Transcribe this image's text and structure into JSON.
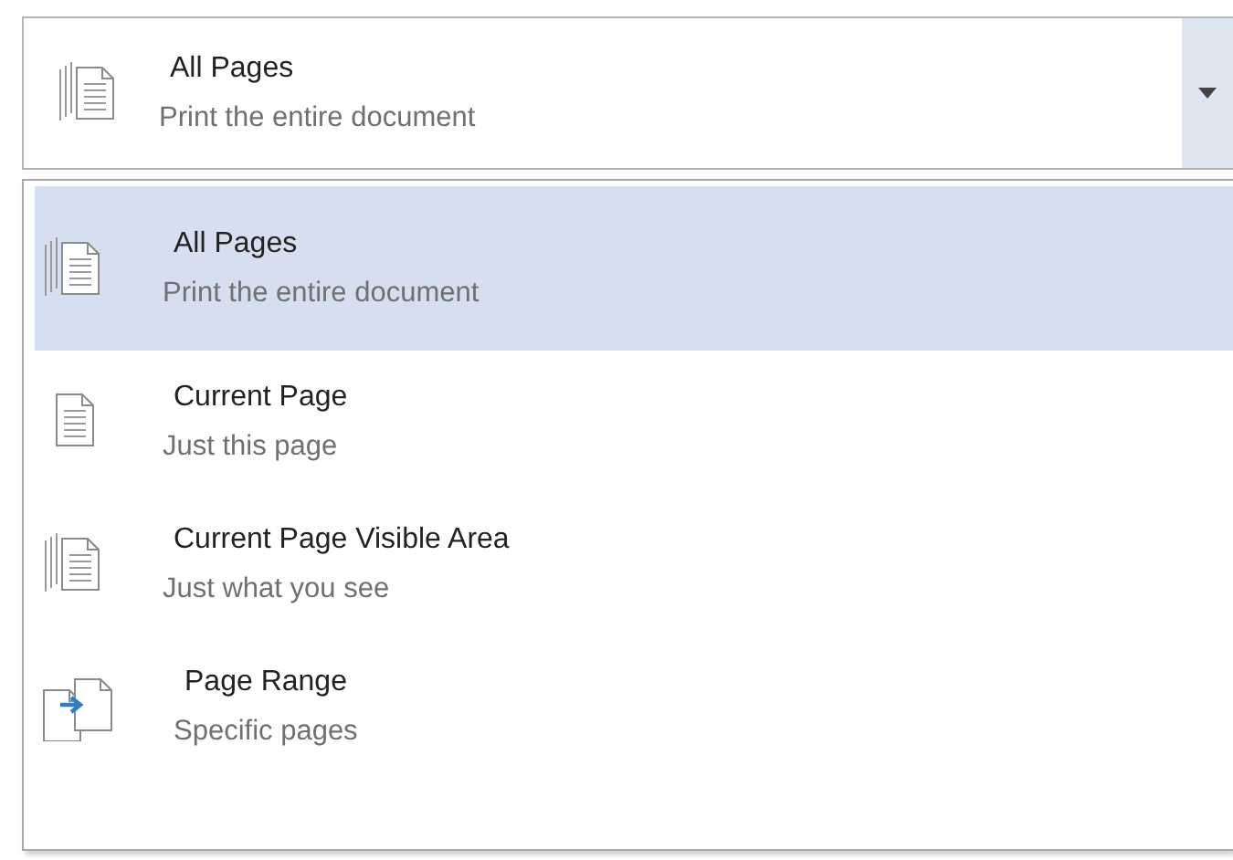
{
  "selector": {
    "kind": "stack",
    "title": "All Pages",
    "subtitle": "Print the entire document"
  },
  "options": [
    {
      "kind": "stack",
      "title": "All Pages",
      "subtitle": "Print the entire document",
      "selected": true
    },
    {
      "kind": "single",
      "title": "Current Page",
      "subtitle": "Just this page",
      "selected": false
    },
    {
      "kind": "stack",
      "title": "Current Page Visible Area",
      "subtitle": "Just what you see",
      "selected": false
    },
    {
      "kind": "range",
      "title": "Page Range",
      "subtitle": "Specific pages",
      "selected": false
    }
  ]
}
